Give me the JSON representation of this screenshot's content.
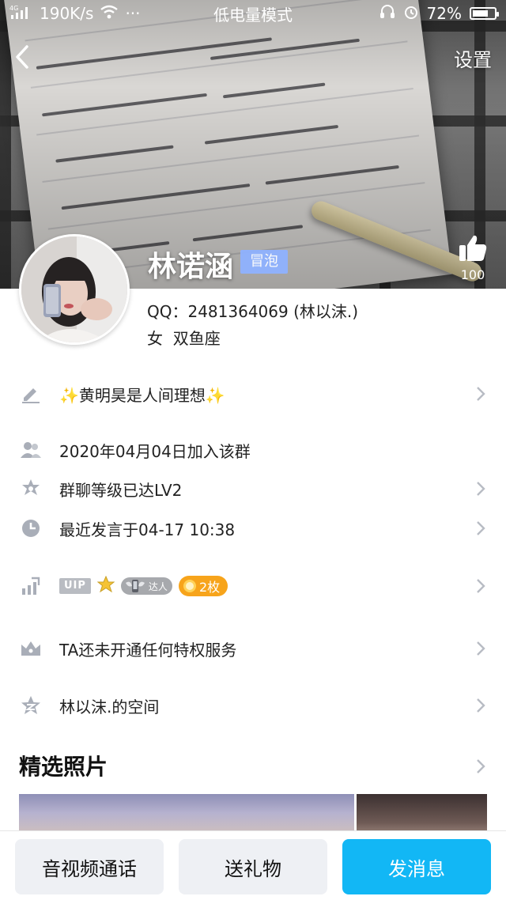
{
  "status_bar": {
    "network": "4G",
    "speed": "190K/s",
    "more": "···",
    "mode_text": "低电量模式",
    "battery_percent": "72%",
    "battery_level": 0.72
  },
  "nav": {
    "back_icon": "chevron-left-icon",
    "settings_label": "设置"
  },
  "profile": {
    "name": "林诺涵",
    "badge": "冒泡",
    "likes": "100",
    "qq_line": "QQ：2481364069 (林以沫.)",
    "gender": "女",
    "zodiac": "双鱼座"
  },
  "rows": {
    "signature": "✨黄明昊是人间理想✨",
    "joined": "2020年04月04日加入该群",
    "group_level": "群聊等级已达LV2",
    "last_post": "最近发言于04-17 10:38",
    "vip_tag": "UIP",
    "daren_label": "达人",
    "medal_count": "2枚",
    "privilege": "TA还未开通任何特权服务",
    "space": "林以沫.的空间"
  },
  "photos": {
    "title": "精选照片"
  },
  "bottom_bar": {
    "call_label": "音视频通话",
    "gift_label": "送礼物",
    "message_label": "发消息"
  },
  "colors": {
    "accent": "#12b7f5",
    "badge_blue": "#8fb2ff",
    "medal_orange": "#f7a41b",
    "icon_gray": "#a9aeb8"
  }
}
